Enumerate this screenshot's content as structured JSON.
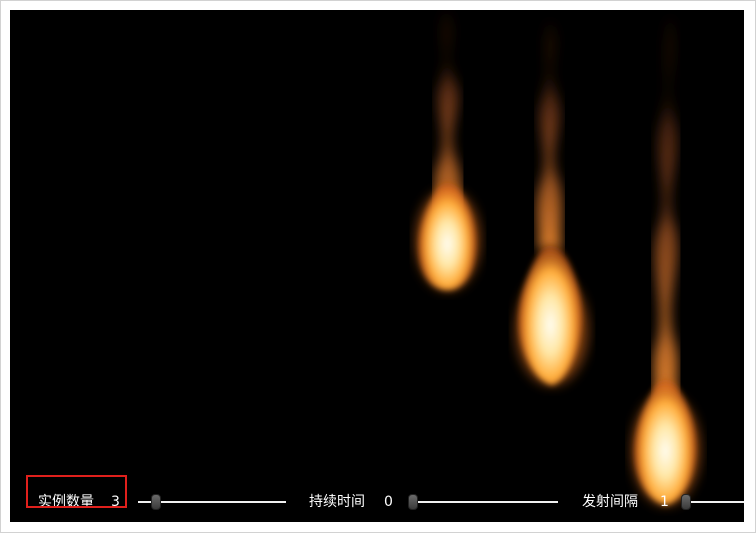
{
  "colors": {
    "background": "#000000",
    "flame_core": "#fff6d8",
    "flame_mid": "#ffb347",
    "flame_outer": "#d2691e",
    "smoke": "#b0502a",
    "highlight_box": "#e0201c"
  },
  "controls": {
    "instance_count": {
      "label": "实例数量",
      "value": "3",
      "level": 0.1
    },
    "duration": {
      "label": "持续时间",
      "value": "0",
      "level": 0.0
    },
    "emit_interval": {
      "label": "发射间隔",
      "value": "1",
      "level": 0.1
    }
  }
}
